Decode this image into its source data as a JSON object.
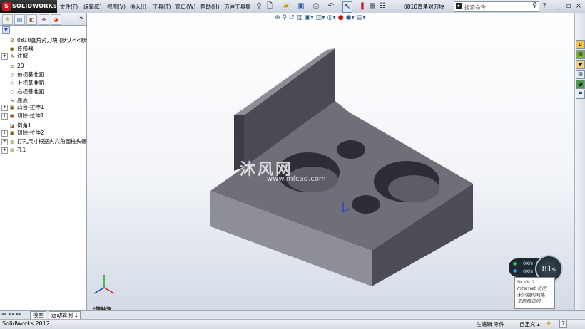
{
  "app": {
    "logo_text": "SOLIDWORKS",
    "logo_mark": "S"
  },
  "menu": [
    "文件(F)",
    "编辑(E)",
    "视图(V)",
    "插入(I)",
    "工具(T)",
    "窗口(W)",
    "帮助(H)",
    "迈迪工具集"
  ],
  "document_title": "0810直角对刀块",
  "search": {
    "placeholder": "搜索命令"
  },
  "window_buttons": {
    "help": "?",
    "minimize": "_",
    "restore": "▫",
    "close": "×"
  },
  "panel": {
    "collapse": "»",
    "tree": [
      {
        "label": "0810直角对刀块  (默认<<默认>_",
        "icon": "part-icon",
        "glyph": "⚙",
        "expand": ""
      },
      {
        "label": "传感器",
        "icon": "sensor-icon",
        "glyph": "◉",
        "expand": ""
      },
      {
        "label": "注解",
        "icon": "annotation-icon",
        "glyph": "A",
        "expand": "+"
      },
      {
        "label": "20",
        "icon": "material-icon",
        "glyph": "≡",
        "expand": ""
      },
      {
        "label": "前视基准面",
        "icon": "plane-icon",
        "glyph": "◇",
        "expand": ""
      },
      {
        "label": "上视基准面",
        "icon": "plane-icon",
        "glyph": "◇",
        "expand": ""
      },
      {
        "label": "右视基准面",
        "icon": "plane-icon",
        "glyph": "◇",
        "expand": ""
      },
      {
        "label": "原点",
        "icon": "origin-icon",
        "glyph": "↳",
        "expand": ""
      },
      {
        "label": "凸台-拉伸1",
        "icon": "extrude-icon",
        "glyph": "▣",
        "expand": "+"
      },
      {
        "label": "切除-拉伸1",
        "icon": "cut-icon",
        "glyph": "▣",
        "expand": "+"
      },
      {
        "label": "倒角1",
        "icon": "chamfer-icon",
        "glyph": "◪",
        "expand": ""
      },
      {
        "label": "切除-拉伸2",
        "icon": "cut-icon",
        "glyph": "▣",
        "expand": "+"
      },
      {
        "label": "打孔尺寸根据内六角圆柱头螺",
        "icon": "hole-wizard-icon",
        "glyph": "◍",
        "expand": "+"
      },
      {
        "label": "孔1",
        "icon": "hole-icon",
        "glyph": "◍",
        "expand": "+"
      }
    ]
  },
  "viewport": {
    "view_label": "*等轴测",
    "watermark_main": "沐风网",
    "watermark_sub": "www.mfcad.com"
  },
  "net_widget": {
    "up": "0K/s",
    "down": "0K/s",
    "cpu": "81",
    "cpu_unit": "%",
    "tip_lines": [
      "NcNic  2",
      "Internet 访问",
      "未识别的网络",
      "无网络访问"
    ]
  },
  "bottom_tabs": [
    "模型",
    "运动算例 1"
  ],
  "status": {
    "version": "SolidWorks 2012",
    "mode": "在编辑 零件",
    "custom": "自定义",
    "help": "?"
  },
  "colors": {
    "accent": "#c8161e",
    "part_face": "#6e6f78",
    "part_dark": "#4b4954",
    "part_top": "#8c8d96"
  }
}
